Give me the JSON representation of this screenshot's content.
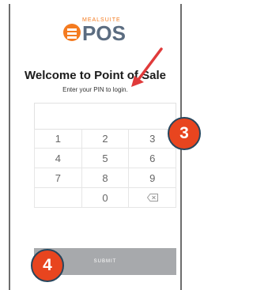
{
  "logo": {
    "brand_small": "MEALSUITE",
    "brand_big": "POS"
  },
  "title": "Welcome to Point of Sale",
  "subtitle": "Enter your PIN to login.",
  "keypad": {
    "rows": [
      [
        "1",
        "2",
        "3"
      ],
      [
        "4",
        "5",
        "6"
      ],
      [
        "7",
        "8",
        "9"
      ],
      [
        "",
        "0",
        "backspace"
      ]
    ]
  },
  "submit_label": "SUBMIT",
  "callouts": {
    "step3": "3",
    "step4": "4"
  },
  "colors": {
    "accent": "#f47b20",
    "callout": "#e8451f",
    "submit_bg": "#a7a9ac",
    "arrow": "#e03a3a"
  }
}
